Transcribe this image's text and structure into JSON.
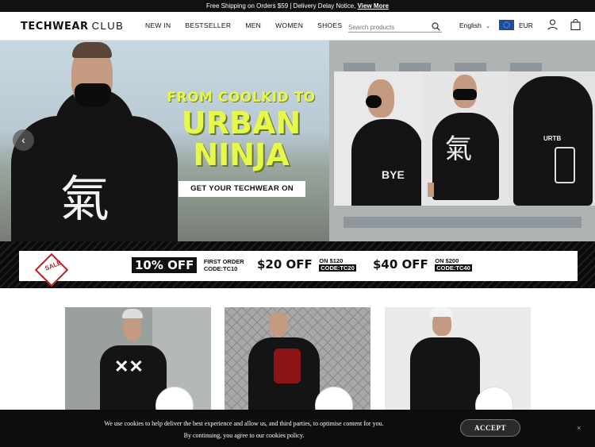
{
  "announcement": {
    "text": "Free Shipping on Orders $59 | Delivery Delay Notice, ",
    "link": "View More"
  },
  "header": {
    "logo_bold": "TECHWEAR",
    "logo_light": "CLUB",
    "nav": [
      "NEW IN",
      "BESTSELLER",
      "MEN",
      "WOMEN",
      "SHOES"
    ],
    "search_placeholder": "Search products",
    "language": "English",
    "currency": "EUR"
  },
  "hero": {
    "line1": "FROM COOLKID TO",
    "line2a": "URBAN",
    "line2b": "NINJA",
    "cta": "GET YOUR TECHWEAR ON",
    "accent_color": "#e6f84a"
  },
  "promo": {
    "badge": "SALE",
    "offers": [
      {
        "main": "10% OFF",
        "line1": "FIRST ORDER",
        "line2": "CODE:TC10"
      },
      {
        "main": "$20 OFF",
        "line1": "ON $120",
        "line2": "CODE:TC20"
      },
      {
        "main": "$40 OFF",
        "line1": "ON $200",
        "line2": "CODE:TC40"
      }
    ]
  },
  "cookie": {
    "line1": "We use cookies to help deliver the best experience and allow us, and third parties, to optimise content for you.",
    "line2": "By continuing, you agree to our cookies policy.",
    "accept": "ACCEPT",
    "close": "×"
  }
}
